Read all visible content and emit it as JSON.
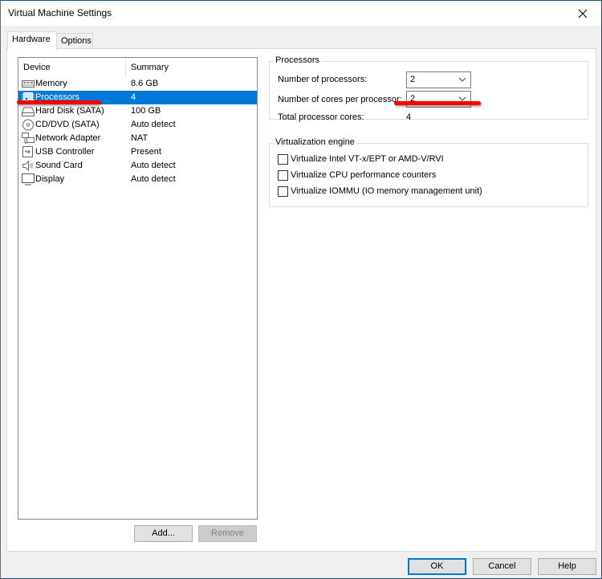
{
  "window": {
    "title": "Virtual Machine Settings",
    "close_icon": "close-icon"
  },
  "tabs": [
    {
      "label": "Hardware",
      "active": true
    },
    {
      "label": "Options",
      "active": false
    }
  ],
  "device_list": {
    "columns": [
      "Device",
      "Summary"
    ],
    "rows": [
      {
        "icon": "memory-icon",
        "device": "Memory",
        "summary": "8.6 GB",
        "selected": false
      },
      {
        "icon": "processor-icon",
        "device": "Processors",
        "summary": "4",
        "selected": true
      },
      {
        "icon": "hard-disk-icon",
        "device": "Hard Disk (SATA)",
        "summary": "100 GB",
        "selected": false
      },
      {
        "icon": "cd-dvd-icon",
        "device": "CD/DVD (SATA)",
        "summary": "Auto detect",
        "selected": false
      },
      {
        "icon": "network-adapter-icon",
        "device": "Network Adapter",
        "summary": "NAT",
        "selected": false
      },
      {
        "icon": "usb-icon",
        "device": "USB Controller",
        "summary": "Present",
        "selected": false
      },
      {
        "icon": "sound-card-icon",
        "device": "Sound Card",
        "summary": "Auto detect",
        "selected": false
      },
      {
        "icon": "display-icon",
        "device": "Display",
        "summary": "Auto detect",
        "selected": false
      }
    ],
    "add_label": "Add...",
    "remove_label": "Remove"
  },
  "processors": {
    "group_label": "Processors",
    "num_processors_label": "Number of processors:",
    "num_processors_value": "2",
    "cores_per_processor_label": "Number of cores per processor:",
    "cores_per_processor_value": "2",
    "total_cores_label": "Total processor cores:",
    "total_cores_value": "4"
  },
  "virtualization": {
    "group_label": "Virtualization engine",
    "options": [
      {
        "label": "Virtualize Intel VT-x/EPT or AMD-V/RVI",
        "checked": false
      },
      {
        "label": "Virtualize CPU performance counters",
        "checked": false
      },
      {
        "label": "Virtualize IOMMU (IO memory management unit)",
        "checked": false
      }
    ]
  },
  "footer": {
    "ok_label": "OK",
    "cancel_label": "Cancel",
    "help_label": "Help"
  },
  "annotations": {
    "color": "#ff0000"
  },
  "colors": {
    "selection": "#0078d7",
    "window_border": "#1a5276"
  }
}
